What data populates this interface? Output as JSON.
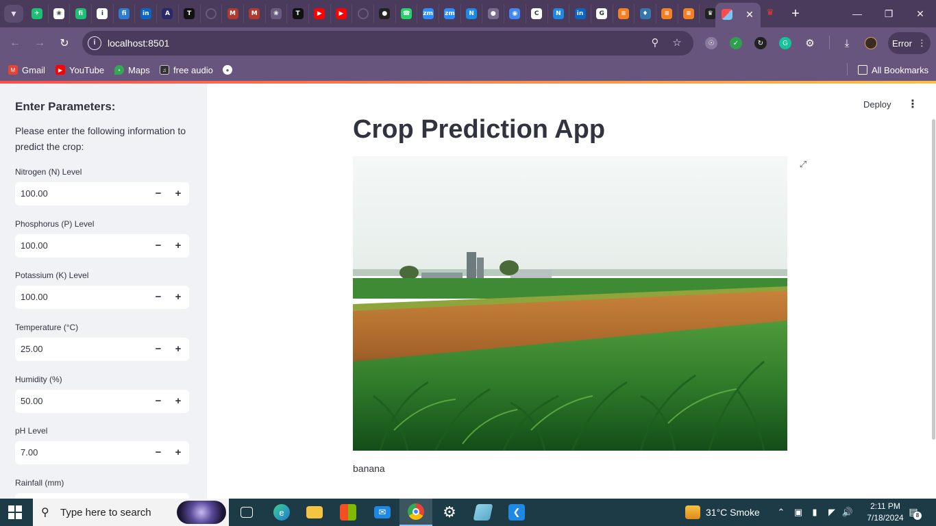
{
  "browser": {
    "tab_menu_icon": "chevron-down-icon",
    "tab_favicons": [
      {
        "name": "fiverr-like-icon",
        "color": "#1dbf73",
        "glyph": "✈"
      },
      {
        "name": "openai-icon",
        "color": "#ffffff",
        "glyph": "❀"
      },
      {
        "name": "fiverr-icon",
        "color": "#1dbf73",
        "glyph": "fi"
      },
      {
        "name": "info-icon",
        "color": "#ffffff",
        "glyph": "i"
      },
      {
        "name": "fi-icon",
        "color": "#2d7cd1",
        "glyph": "fi"
      },
      {
        "name": "linkedin-icon",
        "color": "#0a66c2",
        "glyph": "in"
      },
      {
        "name": "a-icon",
        "color": "#2a2a6a",
        "glyph": "A"
      },
      {
        "name": "t-icon",
        "color": "#111111",
        "glyph": "T"
      },
      {
        "name": "loading-icon",
        "color": "#6a5a7e",
        "glyph": ""
      },
      {
        "name": "m-icon",
        "color": "#b03a2e",
        "glyph": "M"
      },
      {
        "name": "m-icon",
        "color": "#b03a2e",
        "glyph": "M"
      },
      {
        "name": "chatgpt-icon",
        "color": "#6a5a7e",
        "glyph": "❀"
      },
      {
        "name": "t-icon",
        "color": "#111111",
        "glyph": "T"
      },
      {
        "name": "youtube-icon",
        "color": "#ff0000",
        "glyph": "▶"
      },
      {
        "name": "youtube-icon",
        "color": "#ff0000",
        "glyph": "▶"
      },
      {
        "name": "loading-icon",
        "color": "#6a5a7e",
        "glyph": ""
      },
      {
        "name": "github-icon",
        "color": "#222222",
        "glyph": "●"
      },
      {
        "name": "whatsapp-icon",
        "color": "#25d366",
        "glyph": "☎"
      },
      {
        "name": "zoom-icon",
        "color": "#2d8cff",
        "glyph": "zm"
      },
      {
        "name": "zoom-icon",
        "color": "#2d8cff",
        "glyph": "zm"
      },
      {
        "name": "n-icon",
        "color": "#1e88e5",
        "glyph": "N"
      },
      {
        "name": "globe-icon",
        "color": "#7a6a8e",
        "glyph": "●"
      },
      {
        "name": "meet-icon",
        "color": "#4285f4",
        "glyph": "◉"
      },
      {
        "name": "c-icon",
        "color": "#ffffff",
        "glyph": "C"
      },
      {
        "name": "n-icon",
        "color": "#1e88e5",
        "glyph": "N"
      },
      {
        "name": "linkedin-icon",
        "color": "#0a66c2",
        "glyph": "in"
      },
      {
        "name": "google-icon",
        "color": "#ffffff",
        "glyph": "G"
      },
      {
        "name": "stackoverflow-icon",
        "color": "#f48024",
        "glyph": "≡"
      },
      {
        "name": "python-icon",
        "color": "#3776ab",
        "glyph": "♦"
      },
      {
        "name": "stackoverflow-icon",
        "color": "#f48024",
        "glyph": "≡"
      },
      {
        "name": "stackoverflow-icon",
        "color": "#f48024",
        "glyph": "≡"
      },
      {
        "name": "crown-icon",
        "color": "#222222",
        "glyph": "♛"
      }
    ],
    "active_tab": {
      "favicon": "streamlit-icon",
      "close_icon": "close-icon"
    },
    "after_tab_favicon": "crown-red-icon",
    "new_tab_icon": "plus-icon",
    "window_controls": [
      "minimize-icon",
      "restore-icon",
      "close-icon"
    ],
    "url": "localhost:8501",
    "profile_status": "Error"
  },
  "bookmarks": {
    "items": [
      {
        "label": "Gmail",
        "icon": "gmail-icon",
        "color": "#ea4335"
      },
      {
        "label": "YouTube",
        "icon": "youtube-icon",
        "color": "#ff0000"
      },
      {
        "label": "Maps",
        "icon": "maps-icon",
        "color": "#34a853"
      },
      {
        "label": "free audio",
        "icon": "audio-icon",
        "color": "#333333"
      }
    ],
    "all_bookmarks": "All Bookmarks"
  },
  "sidebar": {
    "title": "Enter Parameters:",
    "description": "Please enter the following information to predict the crop:",
    "fields": [
      {
        "label": "Nitrogen (N) Level",
        "value": "100.00"
      },
      {
        "label": "Phosphorus (P) Level",
        "value": "100.00"
      },
      {
        "label": "Potassium (K) Level",
        "value": "100.00"
      },
      {
        "label": "Temperature (°C)",
        "value": "25.00"
      },
      {
        "label": "Humidity (%)",
        "value": "50.00"
      },
      {
        "label": "pH Level",
        "value": "7.00"
      },
      {
        "label": "Rainfall (mm)",
        "value": ""
      }
    ],
    "decrement_glyph": "−",
    "increment_glyph": "+"
  },
  "main": {
    "deploy_label": "Deploy",
    "title": "Crop Prediction App",
    "caption": "banana"
  },
  "taskbar": {
    "search_placeholder": "Type here to search",
    "weather": "31°C  Smoke",
    "time": "2:11 PM",
    "date": "7/18/2024",
    "notification_count": "8"
  },
  "colors": {
    "accent_gradient_start": "#ff4b4b",
    "accent_gradient_end": "#ffbd45",
    "browser_frame": "#4a3b5c",
    "browser_toolbar": "#67557e",
    "sidebar_bg": "#f0f2f6",
    "text": "#31333f",
    "taskbar": "#1c3b47"
  }
}
